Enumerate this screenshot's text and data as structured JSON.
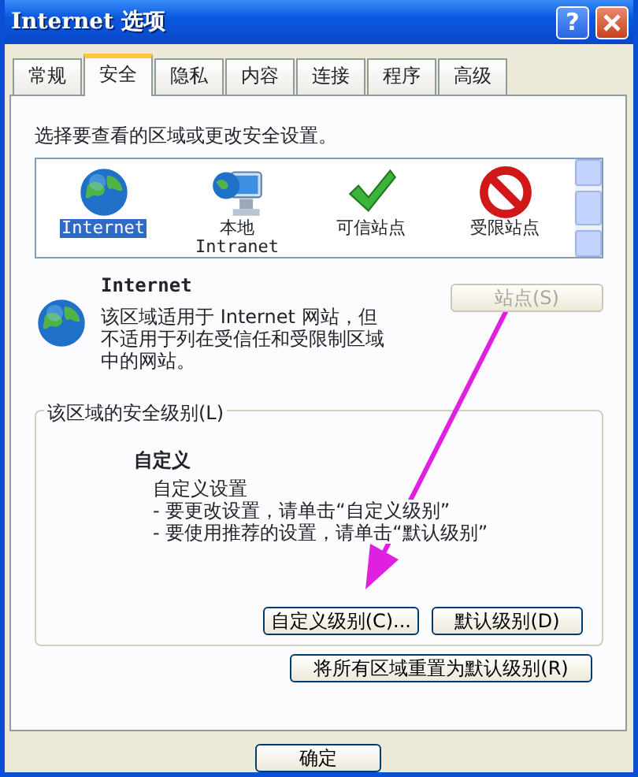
{
  "window": {
    "title": "Internet 选项",
    "help": "?"
  },
  "tabs": [
    {
      "label": "常规",
      "selected": false
    },
    {
      "label": "安全",
      "selected": true
    },
    {
      "label": "隐私",
      "selected": false
    },
    {
      "label": "内容",
      "selected": false
    },
    {
      "label": "连接",
      "selected": false
    },
    {
      "label": "程序",
      "selected": false
    },
    {
      "label": "高级",
      "selected": false
    }
  ],
  "zones": {
    "prompt": "选择要查看的区域或更改安全设置。",
    "items": [
      {
        "kind": "globe",
        "lines": [
          "Internet"
        ],
        "selected": true
      },
      {
        "kind": "intranet",
        "lines": [
          "本地",
          "Intranet"
        ],
        "selected": false
      },
      {
        "kind": "trusted",
        "lines": [
          "可信站点"
        ],
        "selected": false
      },
      {
        "kind": "restricted",
        "lines": [
          "受限站点"
        ],
        "selected": false
      }
    ]
  },
  "zone_info": {
    "kind": "globe",
    "name": "Internet",
    "description": "该区域适用于 Internet 网站，但不适用于列在受信任和受限制区域中的网站。",
    "sites_button": {
      "label": "站点(S)",
      "disabled": true
    }
  },
  "security_level": {
    "legend": "该区域的安全级别(L)",
    "level_name": "自定义",
    "lines": [
      "自定义设置",
      "- 要更改设置，请单击“自定义级别”",
      "- 要使用推荐的设置，请单击“默认级别”"
    ],
    "buttons": [
      {
        "label": "自定义级别(C)..."
      },
      {
        "label": "默认级别(D)"
      }
    ]
  },
  "reset_button": {
    "label": "将所有区域重置为默认级别(R)"
  },
  "dialog_buttons": [
    {
      "label": "确定"
    }
  ]
}
